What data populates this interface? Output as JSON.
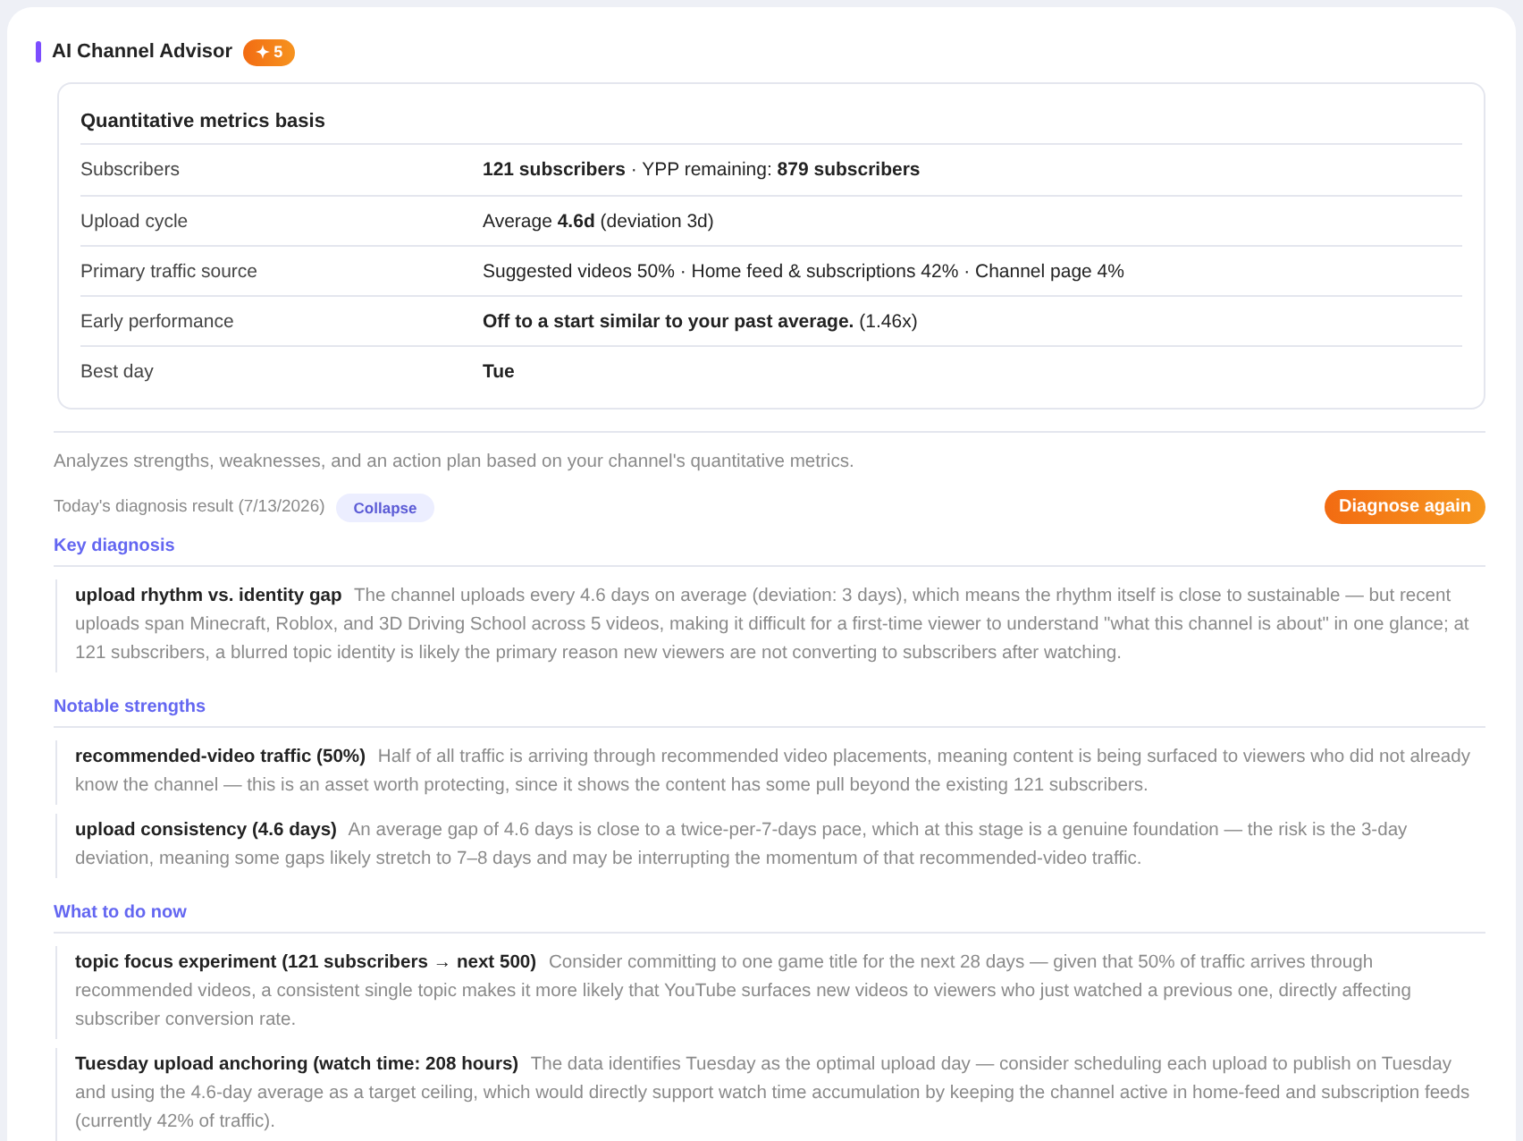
{
  "header": {
    "title": "AI Channel Advisor",
    "badge": "5"
  },
  "metrics": {
    "title": "Quantitative metrics basis",
    "rows": [
      {
        "label": "Subscribers",
        "value": "**121 subscribers** · YPP remaining: **879 subscribers**",
        "strong": false
      },
      {
        "label": "Upload cycle",
        "value": "Average **4.6d** (deviation 3d)",
        "strong": false
      },
      {
        "label": "Primary traffic source",
        "value": "Suggested videos 50% · Home feed & subscriptions 42% · Channel page 4%",
        "strong": false
      },
      {
        "label": "Early performance",
        "value": "**Off to a start similar to your past average.** (1.46x)",
        "strong": false
      },
      {
        "label": "Best day",
        "value": "Tue",
        "strong": true
      }
    ]
  },
  "description": "Analyzes strengths, weaknesses, and an action plan based on your channel's quantitative metrics.",
  "result": {
    "label": "Today's diagnosis result (7/13/2026)",
    "collapse": "Collapse",
    "diagnose": "Diagnose again"
  },
  "sections": [
    {
      "heading": "Key diagnosis",
      "items": [
        {
          "title": "upload rhythm vs. identity gap",
          "text": "The channel uploads every 4.6 days on average (deviation: 3 days), which means the rhythm itself is close to sustainable — but recent uploads span Minecraft, Roblox, and 3D Driving School across 5 videos, making it difficult for a first-time viewer to understand \"what this channel is about\" in one glance; at 121 subscribers, a blurred topic identity is likely the primary reason new viewers are not converting to subscribers after watching."
        }
      ]
    },
    {
      "heading": "Notable strengths",
      "items": [
        {
          "title": "recommended-video traffic (50%)",
          "text": "Half of all traffic is arriving through recommended video placements, meaning content is being surfaced to viewers who did not already know the channel — this is an asset worth protecting, since it shows the content has some pull beyond the existing 121 subscribers."
        },
        {
          "title": "upload consistency (4.6 days)",
          "text": "An average gap of 4.6 days is close to a twice-per-7-days pace, which at this stage is a genuine foundation — the risk is the 3-day deviation, meaning some gaps likely stretch to 7–8 days and may be interrupting the momentum of that recommended-video traffic."
        }
      ]
    },
    {
      "heading": "What to do now",
      "items": [
        {
          "title": "topic focus experiment (121 subscribers → next 500)",
          "text": "Consider committing to one game title for the next 28 days — given that 50% of traffic arrives through recommended videos, a consistent single topic makes it more likely that YouTube surfaces new videos to viewers who just watched a previous one, directly affecting subscriber conversion rate."
        },
        {
          "title": "Tuesday upload anchoring (watch time: 208 hours)",
          "text": "The data identifies Tuesday as the optimal upload day — consider scheduling each upload to publish on Tuesday and using the 4.6-day average as a target ceiling, which would directly support watch time accumulation by keeping the channel active in home-feed and subscription feeds (currently 42% of traffic)."
        }
      ]
    }
  ]
}
